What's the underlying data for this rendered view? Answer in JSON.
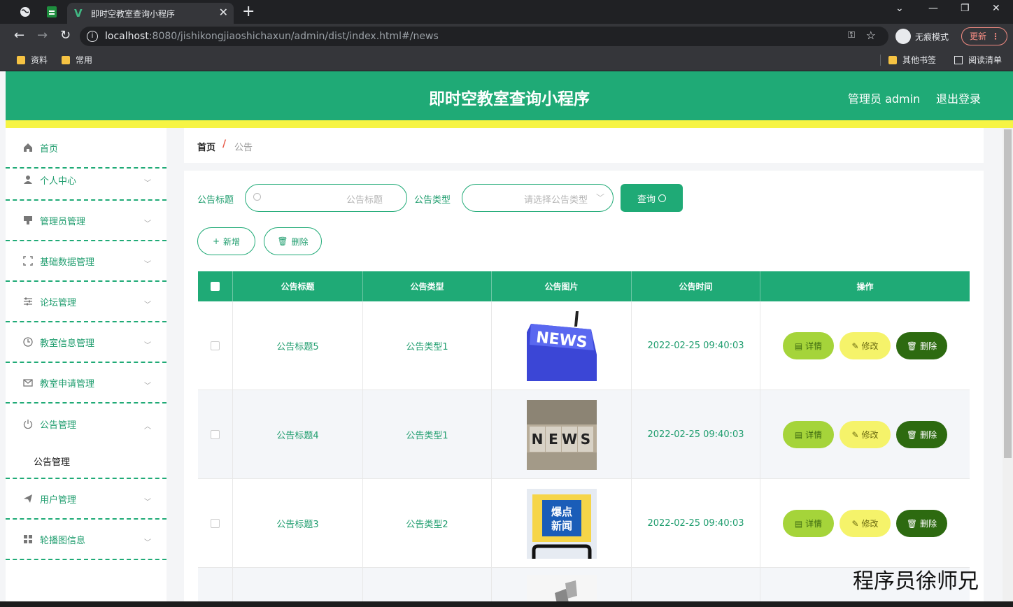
{
  "browser": {
    "active_tab_title": "即时空教室查询小程序",
    "url_host": "localhost",
    "url_rest": ":8080/jishikongjiaoshichaxun/admin/dist/index.html#/news",
    "incognito_label": "无痕模式",
    "update_label": "更新",
    "bookmarks": [
      "资料",
      "常用"
    ],
    "right_bookmarks": [
      "其他书签",
      "阅读清单"
    ]
  },
  "header": {
    "title": "即时空教室查询小程序",
    "user": "管理员 admin",
    "logout": "退出登录",
    "color": "#1faa76"
  },
  "sidebar": {
    "items": [
      {
        "label": "首页",
        "icon": "home-icon"
      },
      {
        "label": "个人中心",
        "icon": "user-icon"
      },
      {
        "label": "管理员管理",
        "icon": "admin-icon"
      },
      {
        "label": "基础数据管理",
        "icon": "fullscreen-icon"
      },
      {
        "label": "论坛管理",
        "icon": "sliders-icon"
      },
      {
        "label": "教室信息管理",
        "icon": "clock-icon"
      },
      {
        "label": "教室申请管理",
        "icon": "mail-icon"
      },
      {
        "label": "公告管理",
        "icon": "power-icon"
      },
      {
        "label": "用户管理",
        "icon": "send-icon"
      },
      {
        "label": "轮播图信息",
        "icon": "grid-icon"
      }
    ],
    "sub_item": "公告管理"
  },
  "breadcrumb": {
    "home": "首页",
    "separator": "/",
    "current": "公告"
  },
  "filters": {
    "title_label": "公告标题",
    "title_placeholder": "公告标题",
    "type_label": "公告类型",
    "type_placeholder": "请选择公告类型",
    "query_button": "查询",
    "add_button": "新增",
    "delete_button": "删除"
  },
  "table": {
    "headers": [
      "公告标题",
      "公告类型",
      "公告图片",
      "公告时间",
      "操作"
    ],
    "rows": [
      {
        "title": "公告标题5",
        "type": "公告类型1",
        "time": "2022-02-25 09:40:03",
        "image": "news-keyboard-image"
      },
      {
        "title": "公告标题4",
        "type": "公告类型1",
        "time": "2022-02-25 09:40:03",
        "image": "news-blocks-image"
      },
      {
        "title": "公告标题3",
        "type": "公告类型2",
        "time": "2022-02-25 09:40:03",
        "image": "breaking-news-phone-image"
      }
    ],
    "actions": {
      "detail": "详情",
      "edit": "修改",
      "delete": "删除"
    }
  },
  "watermark": "程序员徐师兄"
}
